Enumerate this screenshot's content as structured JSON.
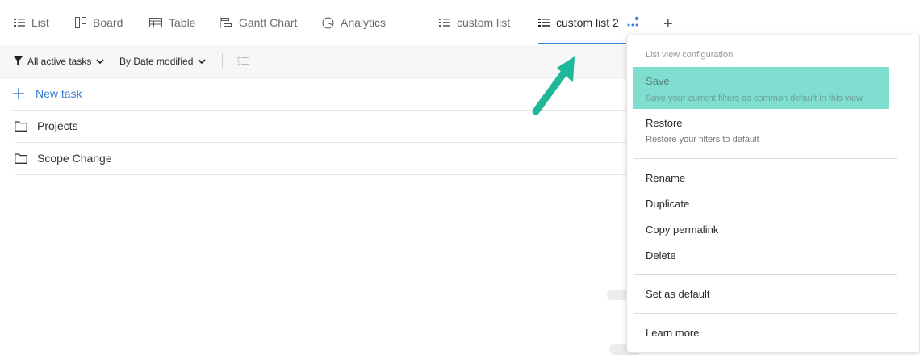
{
  "tabs": [
    {
      "label": "List",
      "icon": "list-icon"
    },
    {
      "label": "Board",
      "icon": "board-icon"
    },
    {
      "label": "Table",
      "icon": "table-icon"
    },
    {
      "label": "Gantt Chart",
      "icon": "gantt-icon"
    },
    {
      "label": "Analytics",
      "icon": "analytics-icon"
    },
    {
      "label": "custom list",
      "icon": "list-icon"
    },
    {
      "label": "custom list 2",
      "icon": "list-icon",
      "active": true
    }
  ],
  "toolbar": {
    "filter_label": "All active tasks",
    "sort_label": "By Date modified"
  },
  "list": {
    "new_task": "New task",
    "rows": [
      "Projects",
      "Scope Change"
    ]
  },
  "menu": {
    "header": "List view configuration",
    "save_label": "Save",
    "save_desc": "Save your current filters as common default in this view",
    "restore_label": "Restore",
    "restore_desc": "Restore your filters to default",
    "items": [
      "Rename",
      "Duplicate",
      "Copy permalink",
      "Delete"
    ],
    "set_default": "Set as default",
    "learn_more": "Learn more"
  },
  "colors": {
    "accent": "#3b82d6",
    "highlight": "#7fded0",
    "arrow": "#1fb89a"
  }
}
